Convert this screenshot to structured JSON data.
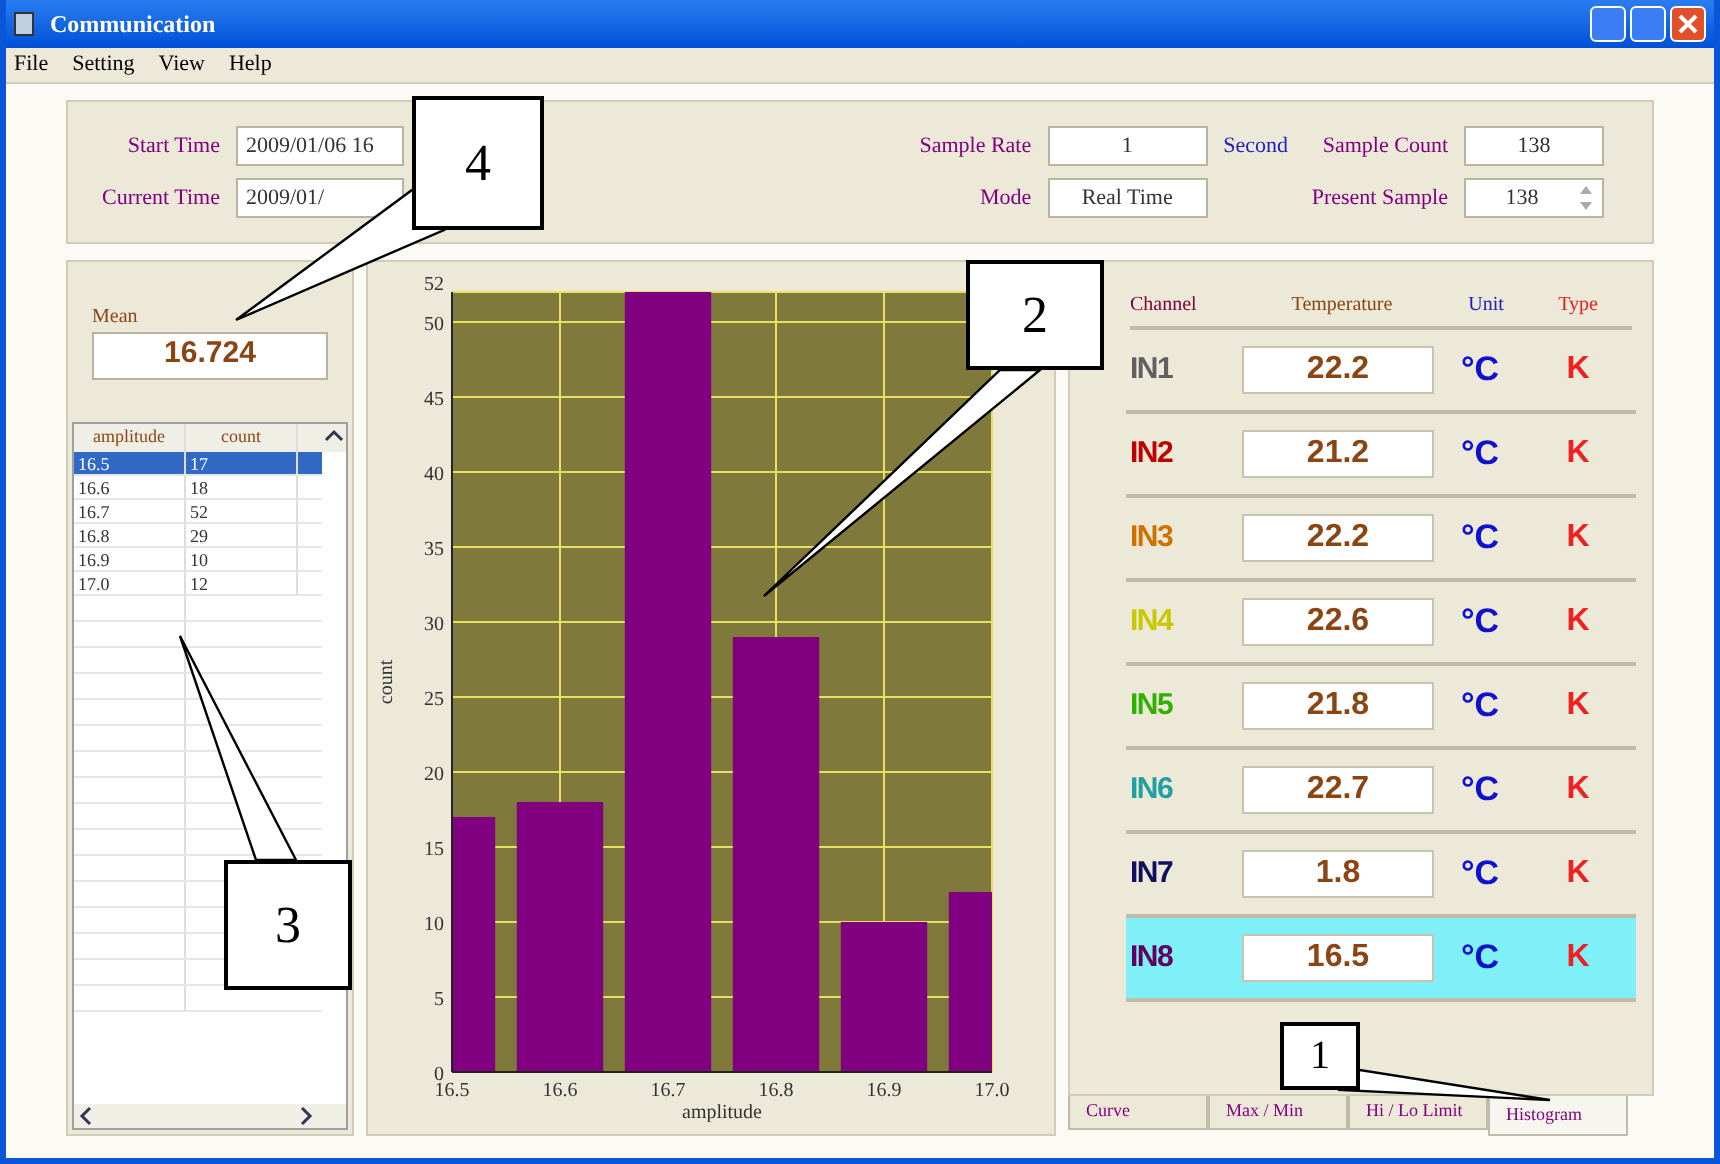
{
  "window": {
    "title": "Communication"
  },
  "menu": [
    "File",
    "Setting",
    "View",
    "Help"
  ],
  "header": {
    "start_time_label": "Start Time",
    "start_time": "2009/01/06 16",
    "current_time_label": "Current Time",
    "current_time": "2009/01/",
    "sample_rate_label": "Sample Rate",
    "sample_rate": "1",
    "sample_rate_unit": "Second",
    "mode_label": "Mode",
    "mode": "Real Time",
    "sample_count_label": "Sample Count",
    "sample_count": "138",
    "present_sample_label": "Present Sample",
    "present_sample": "138"
  },
  "mean": {
    "label": "Mean",
    "value": "16.724"
  },
  "table": {
    "columns": [
      "amplitude",
      "count"
    ],
    "rows": [
      {
        "cells": [
          "16.5",
          "17"
        ],
        "selected": true
      },
      {
        "cells": [
          "16.6",
          "18"
        ],
        "selected": false
      },
      {
        "cells": [
          "16.7",
          "52"
        ],
        "selected": false
      },
      {
        "cells": [
          "16.8",
          "29"
        ],
        "selected": false
      },
      {
        "cells": [
          "16.9",
          "10"
        ],
        "selected": false
      },
      {
        "cells": [
          "17.0",
          "12"
        ],
        "selected": false
      }
    ]
  },
  "histogram": {
    "chart_data": {
      "type": "bar",
      "xlabel": "amplitude",
      "ylabel": "count",
      "categories": [
        "16.5",
        "16.6",
        "16.7",
        "16.8",
        "16.9",
        "17.0"
      ],
      "values": [
        17,
        18,
        52,
        29,
        10,
        12
      ],
      "grid": true,
      "ylim": [
        0,
        52
      ],
      "yticks": [
        0,
        5,
        10,
        15,
        20,
        25,
        30,
        35,
        40,
        45,
        50,
        52
      ]
    }
  },
  "channel_table": {
    "columns": [
      "Channel",
      "Temperature",
      "Unit",
      "Type"
    ],
    "channels": [
      {
        "name": "IN1",
        "color": "#606060",
        "temperature": "22.2",
        "unit": "°C",
        "type": "K",
        "selected": false
      },
      {
        "name": "IN2",
        "color": "#c00000",
        "temperature": "21.2",
        "unit": "°C",
        "type": "K",
        "selected": false
      },
      {
        "name": "IN3",
        "color": "#d07000",
        "temperature": "22.2",
        "unit": "°C",
        "type": "K",
        "selected": false
      },
      {
        "name": "IN4",
        "color": "#c8c800",
        "temperature": "22.6",
        "unit": "°C",
        "type": "K",
        "selected": false
      },
      {
        "name": "IN5",
        "color": "#30b000",
        "temperature": "21.8",
        "unit": "°C",
        "type": "K",
        "selected": false
      },
      {
        "name": "IN6",
        "color": "#20a0a0",
        "temperature": "22.7",
        "unit": "°C",
        "type": "K",
        "selected": false
      },
      {
        "name": "IN7",
        "color": "#101060",
        "temperature": "1.8",
        "unit": "°C",
        "type": "K",
        "selected": false
      },
      {
        "name": "IN8",
        "color": "#600060",
        "temperature": "16.5",
        "unit": "°C",
        "type": "K",
        "selected": true
      }
    ]
  },
  "tabs": [
    {
      "label": "Curve",
      "selected": false
    },
    {
      "label": "Max / Min",
      "selected": false
    },
    {
      "label": "Hi / Lo Limit",
      "selected": false
    },
    {
      "label": "Histogram",
      "selected": true
    }
  ],
  "callouts": [
    "1",
    "2",
    "3",
    "4"
  ]
}
